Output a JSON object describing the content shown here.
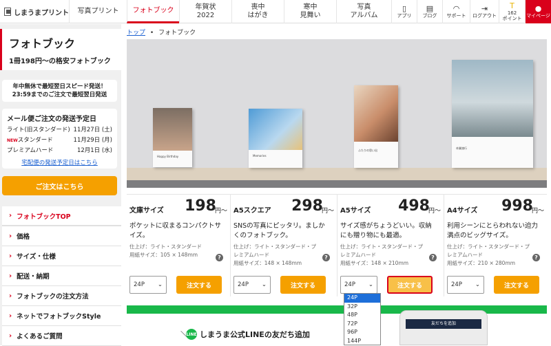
{
  "header": {
    "logo": "しまうまプリント",
    "nav": [
      {
        "label": "写真プリント",
        "active": false
      },
      {
        "label": "フォトブック",
        "active": true
      },
      {
        "label": "年賀状\n2022",
        "active": false
      },
      {
        "label": "喪中\nはがき",
        "active": false
      },
      {
        "label": "寒中\n見舞い",
        "active": false
      },
      {
        "label": "写真\nアルバム",
        "active": false
      }
    ],
    "utils": [
      {
        "icon": "phone-icon",
        "label": "アプリ"
      },
      {
        "icon": "blog-icon",
        "label": "ブログ"
      },
      {
        "icon": "headset-icon",
        "label": "サポート"
      },
      {
        "icon": "logout-icon",
        "label": "ログアウト"
      },
      {
        "icon": "points-icon",
        "label": "162\nポイント"
      },
      {
        "icon": "user-icon",
        "label": "マイページ"
      }
    ]
  },
  "sidebar": {
    "title": "フォトブック",
    "subtitle": "1冊198円～の格安フォトブック",
    "notice": "年中無休で最短翌日スピード発送！\n23:59までのご注文で最短翌日発送",
    "shipping": {
      "heading": "メール便ご注文の発送予定日",
      "rows": [
        {
          "name": "ライト(旧スタンダード)",
          "date": "11月27日 (土)",
          "new": false
        },
        {
          "name": "スタンダード",
          "date": "11月29日 (月)",
          "new": true,
          "badge": "NEW"
        },
        {
          "name": "プレミアムハード",
          "date": "12月1日 (水)",
          "new": false
        }
      ],
      "link": "宅配便の発送予定日はこちら"
    },
    "order_button": "ご注文はこちら",
    "menu": [
      "フォトブックTOP",
      "価格",
      "サイズ・仕様",
      "配送・納期",
      "フォトブックの注文方法",
      "ネットでフォトブックStyle",
      "よくあるご質問"
    ]
  },
  "breadcrumb": {
    "home": "トップ",
    "sep": "•",
    "current": "フォトブック"
  },
  "hero": {
    "books": [
      {
        "caption": "Happy Birthday"
      },
      {
        "caption": "Memories"
      },
      {
        "caption": "ふたりの思い出"
      },
      {
        "caption": "卒業旅行"
      }
    ]
  },
  "products": [
    {
      "name": "文庫サイズ",
      "price": "198",
      "yen": "円～",
      "desc": "ポケットに収まるコンパクトサイズ。",
      "spec": "仕上げ：ライト・スタンダード\n用紙サイズ：105 × 148mm",
      "pages": "24P",
      "order": "注文する",
      "hl": false
    },
    {
      "name": "A5スクエア",
      "price": "298",
      "yen": "円～",
      "desc": "SNSの写真にピッタリ。ましかくのフォトブック。",
      "spec": "仕上げ：ライト・スタンダード・プレミアムハード\n用紙サイズ：148 × 148mm",
      "pages": "24P",
      "order": "注文する",
      "hl": false
    },
    {
      "name": "A5サイズ",
      "price": "498",
      "yen": "円～",
      "desc": "サイズ感がちょうどいい。収納にも贈り物にも最適。",
      "spec": "仕上げ：ライト・スタンダード・プレミアムハード\n用紙サイズ：148 × 210mm",
      "pages": "24P",
      "order": "注文する",
      "hl": true
    },
    {
      "name": "A4サイズ",
      "price": "998",
      "yen": "円～",
      "desc": "利用シーンにとらわれない迫力満点のビッグサイズ。",
      "spec": "仕上げ：ライト・スタンダード・プレミアムハード\n用紙サイズ：210 × 280mm",
      "pages": "24P",
      "order": "注文する",
      "hl": false
    }
  ],
  "dropdown": {
    "options": [
      "24P",
      "32P",
      "48P",
      "72P",
      "96P",
      "144P"
    ],
    "selected": "24P"
  },
  "line_banner": {
    "text": "しまうま公式LINEの友だち追加",
    "badge": "LINE",
    "phone_text": "友だちを追加"
  },
  "colors": {
    "brand_red": "#d9001b",
    "orange": "#f5a000",
    "green": "#19b84a"
  }
}
